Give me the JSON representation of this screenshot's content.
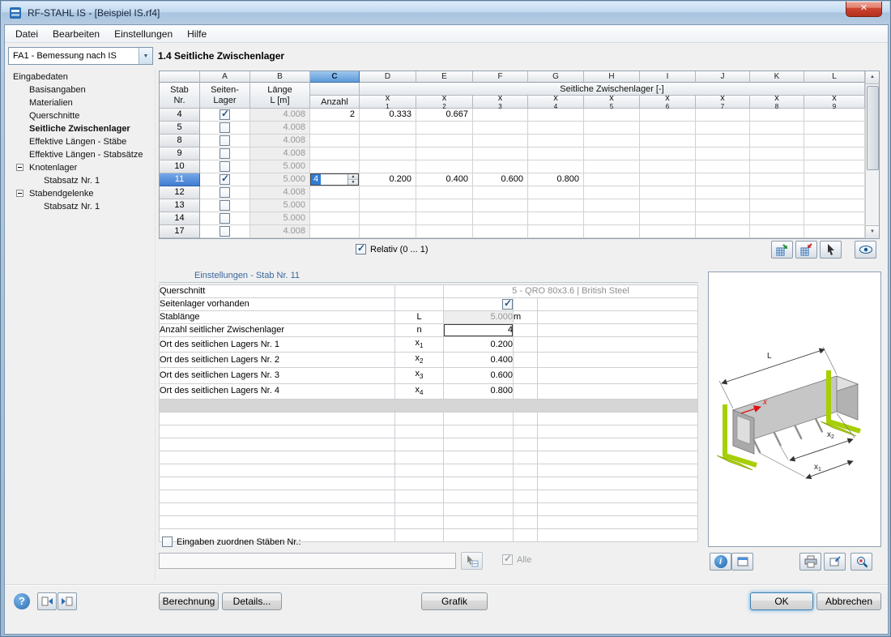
{
  "window": {
    "title": "RF-STAHL IS - [Beispiel IS.rf4]"
  },
  "icons": {
    "close": "✕",
    "dropdown": "▼",
    "check": "✓",
    "spin_up": "▲",
    "spin_down": "▼",
    "help": "?",
    "info": "i"
  },
  "menu": {
    "items": [
      "Datei",
      "Bearbeiten",
      "Einstellungen",
      "Hilfe"
    ]
  },
  "toolbar": {
    "case": "FA1 - Bemessung nach IS",
    "section": "1.4 Seitliche Zwischenlager"
  },
  "nav": {
    "items": [
      {
        "label": "Eingabedaten",
        "level": 0,
        "expander": false,
        "current": false
      },
      {
        "label": "Basisangaben",
        "level": 1,
        "expander": false,
        "current": false
      },
      {
        "label": "Materialien",
        "level": 1,
        "expander": false,
        "current": false
      },
      {
        "label": "Querschnitte",
        "level": 1,
        "expander": false,
        "current": false
      },
      {
        "label": "Seitliche Zwischenlager",
        "level": 1,
        "expander": false,
        "current": true
      },
      {
        "label": "Effektive Längen - Stäbe",
        "level": 1,
        "expander": false,
        "current": false
      },
      {
        "label": "Effektive Längen - Stabsätze",
        "level": 1,
        "expander": false,
        "current": false
      },
      {
        "label": "Knotenlager",
        "level": 1,
        "expander": true,
        "current": false
      },
      {
        "label": "Stabsatz Nr. 1",
        "level": 2,
        "expander": false,
        "current": false
      },
      {
        "label": "Stabendgelenke",
        "level": 1,
        "expander": true,
        "current": false
      },
      {
        "label": "Stabsatz Nr. 1",
        "level": 2,
        "expander": false,
        "current": false
      }
    ]
  },
  "table": {
    "letters": [
      "A",
      "B",
      "C",
      "D",
      "E",
      "F",
      "G",
      "H",
      "I",
      "J",
      "K",
      "L"
    ],
    "highlight_letter": "C",
    "head": {
      "stab": [
        "Stab",
        "Nr."
      ],
      "a": [
        "Seiten-",
        "Lager"
      ],
      "b": [
        "Länge",
        "L [m]"
      ],
      "anzahl": "Anzahl",
      "group": "Seitliche Zwischenlager [-]",
      "xcols": [
        "x1",
        "x2",
        "x3",
        "x4",
        "x5",
        "x6",
        "x7",
        "x8",
        "x9"
      ]
    },
    "rows": [
      {
        "nr": "4",
        "checked": true,
        "len": "4.008",
        "anzahl": "2",
        "editing": false,
        "selected": false,
        "x": [
          "0.333",
          "0.667",
          "",
          "",
          "",
          "",
          "",
          "",
          ""
        ]
      },
      {
        "nr": "5",
        "checked": false,
        "len": "4.008",
        "anzahl": "",
        "editing": false,
        "selected": false,
        "x": [
          "",
          "",
          "",
          "",
          "",
          "",
          "",
          "",
          ""
        ]
      },
      {
        "nr": "8",
        "checked": false,
        "len": "4.008",
        "anzahl": "",
        "editing": false,
        "selected": false,
        "x": [
          "",
          "",
          "",
          "",
          "",
          "",
          "",
          "",
          ""
        ]
      },
      {
        "nr": "9",
        "checked": false,
        "len": "4.008",
        "anzahl": "",
        "editing": false,
        "selected": false,
        "x": [
          "",
          "",
          "",
          "",
          "",
          "",
          "",
          "",
          ""
        ]
      },
      {
        "nr": "10",
        "checked": false,
        "len": "5.000",
        "anzahl": "",
        "editing": false,
        "selected": false,
        "x": [
          "",
          "",
          "",
          "",
          "",
          "",
          "",
          "",
          ""
        ]
      },
      {
        "nr": "11",
        "checked": true,
        "len": "5.000",
        "anzahl": "4",
        "editing": true,
        "selected": true,
        "x": [
          "0.200",
          "0.400",
          "0.600",
          "0.800",
          "",
          "",
          "",
          "",
          ""
        ]
      },
      {
        "nr": "12",
        "checked": false,
        "len": "4.008",
        "anzahl": "",
        "editing": false,
        "selected": false,
        "x": [
          "",
          "",
          "",
          "",
          "",
          "",
          "",
          "",
          ""
        ]
      },
      {
        "nr": "13",
        "checked": false,
        "len": "5.000",
        "anzahl": "",
        "editing": false,
        "selected": false,
        "x": [
          "",
          "",
          "",
          "",
          "",
          "",
          "",
          "",
          ""
        ]
      },
      {
        "nr": "14",
        "checked": false,
        "len": "5.000",
        "anzahl": "",
        "editing": false,
        "selected": false,
        "x": [
          "",
          "",
          "",
          "",
          "",
          "",
          "",
          "",
          ""
        ]
      },
      {
        "nr": "17",
        "checked": false,
        "len": "4.008",
        "anzahl": "",
        "editing": false,
        "selected": false,
        "x": [
          "",
          "",
          "",
          "",
          "",
          "",
          "",
          "",
          ""
        ]
      }
    ],
    "relativ": "Relativ (0 ... 1)"
  },
  "settings": {
    "title": "Einstellungen - Stab Nr. 11",
    "rows": [
      {
        "label": "Querschnitt",
        "sym": "",
        "value": "5 - QRO 80x3.6 | British Steel",
        "unit": "",
        "type": "section"
      },
      {
        "label": "Seitenlager vorhanden",
        "sym": "",
        "value": "",
        "unit": "",
        "type": "check"
      },
      {
        "label": "Stablänge",
        "sym": "L",
        "value": "5.000",
        "unit": "m",
        "type": "readonly"
      },
      {
        "label": "Anzahl seitlicher Zwischenlager",
        "sym": "n",
        "value": "4",
        "unit": "",
        "type": "edit"
      },
      {
        "label": "Ort des seitlichen Lagers Nr. 1",
        "sym": "x1",
        "value": "0.200",
        "unit": "",
        "type": "value"
      },
      {
        "label": "Ort des seitlichen Lagers Nr. 2",
        "sym": "x2",
        "value": "0.400",
        "unit": "",
        "type": "value"
      },
      {
        "label": "Ort des seitlichen Lagers Nr. 3",
        "sym": "x3",
        "value": "0.600",
        "unit": "",
        "type": "value"
      },
      {
        "label": "Ort des seitlichen Lagers Nr. 4",
        "sym": "x4",
        "value": "0.800",
        "unit": "",
        "type": "value"
      },
      {
        "label": "",
        "sym": "",
        "value": "",
        "unit": "",
        "type": "spacer"
      }
    ],
    "empty_rows": 10
  },
  "assign": {
    "label": "Eingaben zuordnen Stäben Nr.:",
    "value": "",
    "alle": "Alle"
  },
  "graphic": {
    "dim_L": "L",
    "axis_x": "x",
    "dim_x1": [
      "x",
      "1"
    ],
    "dim_x2": [
      "x",
      "2"
    ]
  },
  "footer": {
    "berechnung": "Berechnung",
    "details": "Details...",
    "grafik": "Grafik",
    "ok": "OK",
    "abbrechen": "Abbrechen"
  }
}
